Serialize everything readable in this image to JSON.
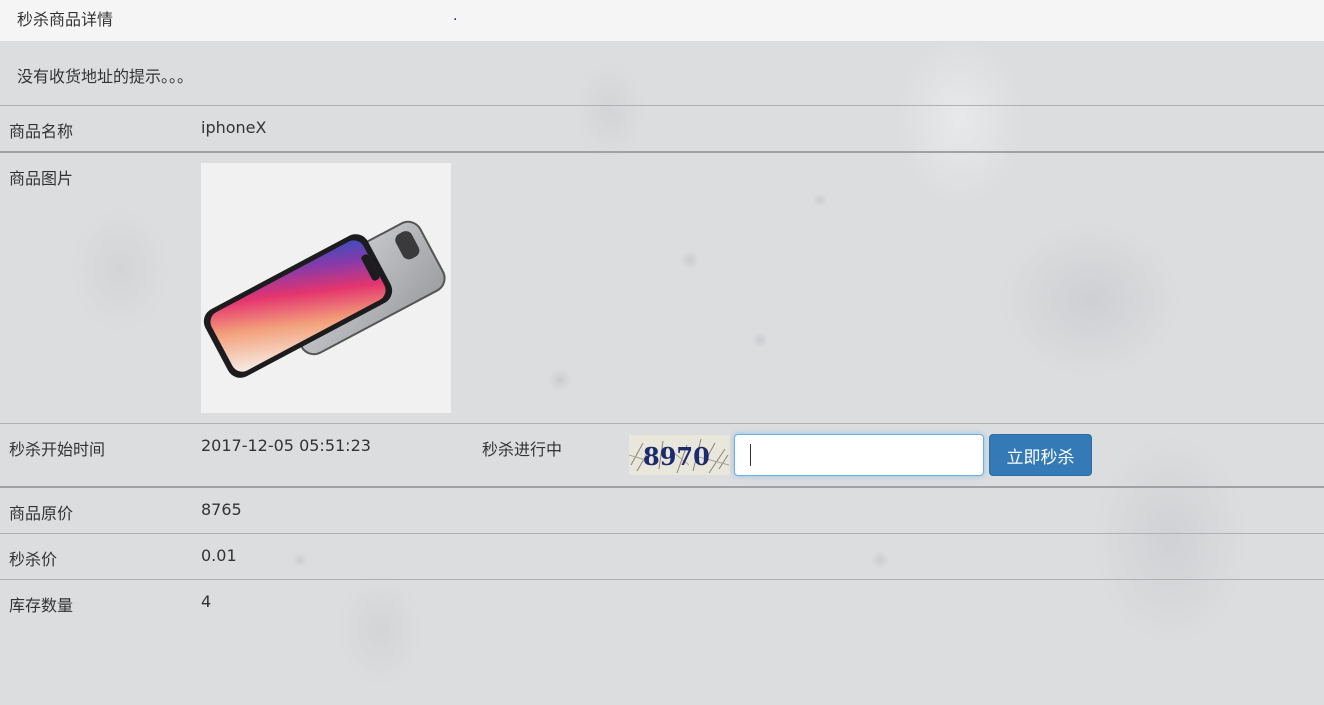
{
  "header": {
    "title": "秒杀商品详情",
    "dot": "."
  },
  "hint": "没有收货地址的提示。。。",
  "goods": {
    "name_label": "商品名称",
    "name": "iphoneX",
    "image_label": "商品图片",
    "image_icon": "iphone-x-product-image",
    "start_label": "秒杀开始时间",
    "start_time": "2017-12-05 05:51:23",
    "status": "秒杀进行中",
    "captcha_text": "8970",
    "captcha_input_value": "",
    "kill_button": "立即秒杀",
    "price_label": "商品原价",
    "price": "8765",
    "seckill_price_label": "秒杀价",
    "seckill_price": "0.01",
    "stock_label": "库存数量",
    "stock": "4"
  },
  "colors": {
    "button": "#337ab7",
    "input_focus": "#66afe9"
  }
}
